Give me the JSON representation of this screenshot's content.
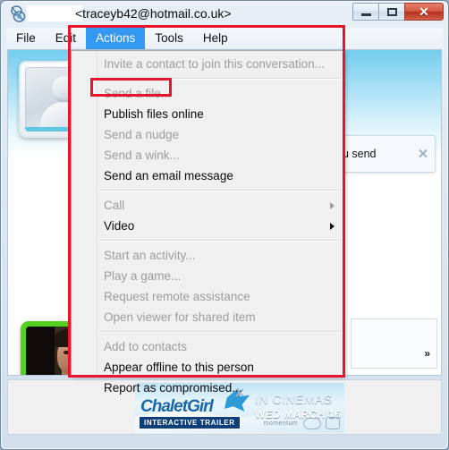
{
  "window": {
    "title": "<traceyb42@hotmail.co.uk>",
    "app_icon": "msn-messenger-icon",
    "controls": {
      "minimize": "minimize-icon",
      "maximize": "maximize-icon",
      "close": "✕"
    }
  },
  "menubar": {
    "items": [
      {
        "label": "File",
        "active": false
      },
      {
        "label": "Edit",
        "active": false
      },
      {
        "label": "Actions",
        "active": true
      },
      {
        "label": "Tools",
        "active": false
      },
      {
        "label": "Help",
        "active": false
      }
    ]
  },
  "actions_menu": {
    "groups": [
      [
        {
          "label": "Invite a contact to join this conversation...",
          "disabled": true,
          "submenu": false
        }
      ],
      [
        {
          "label": "Send a file...",
          "disabled": true,
          "submenu": false,
          "highlighted": true
        },
        {
          "label": "Publish files online",
          "disabled": false,
          "submenu": false
        },
        {
          "label": "Send a nudge",
          "disabled": true,
          "submenu": false
        },
        {
          "label": "Send a wink...",
          "disabled": true,
          "submenu": false
        },
        {
          "label": "Send an email message",
          "disabled": false,
          "submenu": false
        }
      ],
      [
        {
          "label": "Call",
          "disabled": true,
          "submenu": true
        },
        {
          "label": "Video",
          "disabled": false,
          "submenu": true
        }
      ],
      [
        {
          "label": "Start an activity...",
          "disabled": true,
          "submenu": false
        },
        {
          "label": "Play a game...",
          "disabled": true,
          "submenu": false
        },
        {
          "label": "Request remote assistance",
          "disabled": true,
          "submenu": false
        },
        {
          "label": "Open viewer for shared item",
          "disabled": true,
          "submenu": false
        }
      ],
      [
        {
          "label": "Add to contacts",
          "disabled": true,
          "submenu": false
        },
        {
          "label": "Appear offline to this person",
          "disabled": false,
          "submenu": false
        },
        {
          "label": "Report as compromised...",
          "disabled": false,
          "submenu": false
        }
      ]
    ]
  },
  "conversation": {
    "display_picture": "default-contact-avatar",
    "toast": {
      "text": "ou send",
      "close_icon": "✕"
    },
    "webcam_photo": "contact-photo",
    "expander_label": "»"
  },
  "ad": {
    "brand": "ChaletGirl",
    "line1": "IN CINEMAS",
    "line2": "WED MARCH 16",
    "badge": "INTERACTIVE TRAILER",
    "studio": "momentum",
    "close_icon": "✕"
  },
  "annotations": {
    "accent_color": "#e8142d",
    "boxes": [
      {
        "name": "actions-menu-region"
      },
      {
        "name": "send-a-file-item"
      }
    ]
  }
}
